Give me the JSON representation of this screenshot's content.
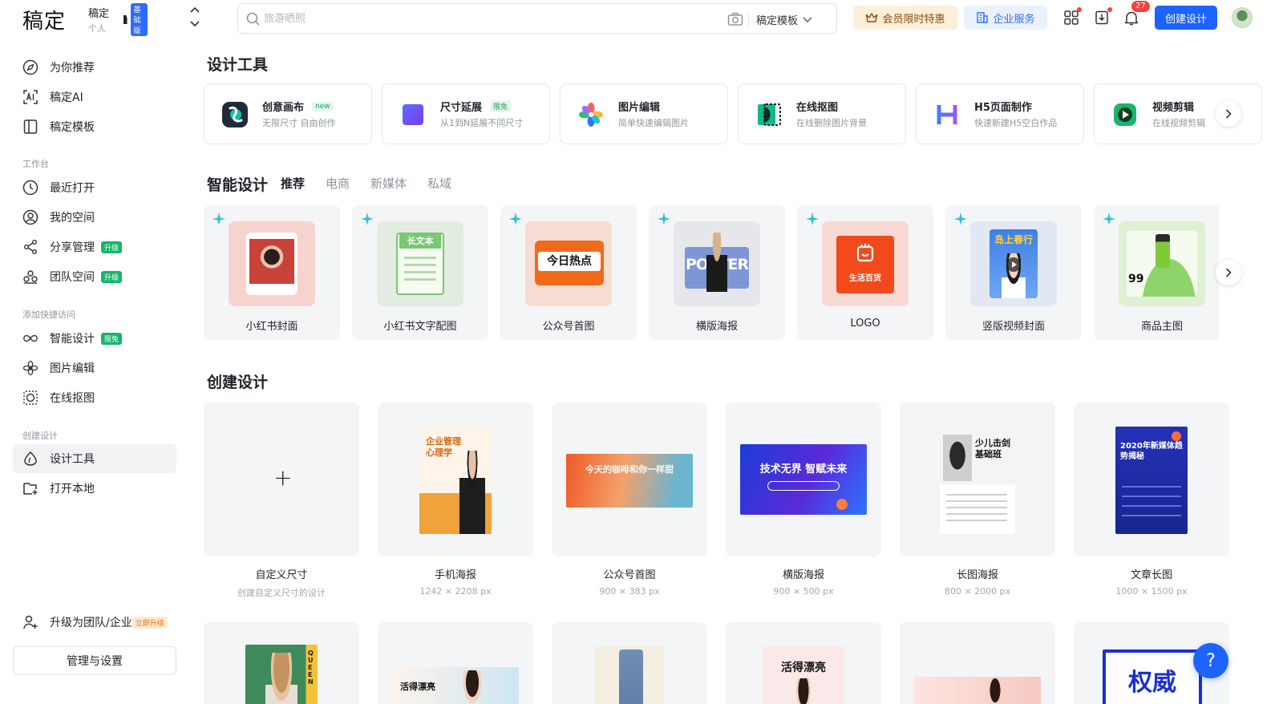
{
  "header": {
    "logo": "稿定",
    "workspace_name": "稿定",
    "workspace_tier": "基础版",
    "workspace_type": "个人",
    "search_placeholder": "旅游晒照",
    "search_scope": "稿定模板",
    "vip_label": "会员限时特惠",
    "enterprise_label": "企业服务",
    "notification_count": "27",
    "create_label": "创建设计"
  },
  "sidebar": {
    "top_items": [
      {
        "label": "为你推荐",
        "icon": "compass-icon"
      },
      {
        "label": "稿定AI",
        "icon": "ai-icon"
      },
      {
        "label": "稿定模板",
        "icon": "template-icon"
      }
    ],
    "sections": {
      "workbench": "工作台",
      "quick_access": "添加快捷访问",
      "create": "创建设计"
    },
    "workbench_items": [
      {
        "label": "最近打开",
        "icon": "clock-icon",
        "tag": ""
      },
      {
        "label": "我的空间",
        "icon": "user-circle-icon",
        "tag": ""
      },
      {
        "label": "分享管理",
        "icon": "share-icon",
        "tag": "升级"
      },
      {
        "label": "团队空间",
        "icon": "team-icon",
        "tag": "升级"
      }
    ],
    "quick_items": [
      {
        "label": "智能设计",
        "icon": "infinity-icon",
        "tag": "限免"
      },
      {
        "label": "图片编辑",
        "icon": "flower-icon",
        "tag": ""
      },
      {
        "label": "在线抠图",
        "icon": "cutout-icon",
        "tag": ""
      }
    ],
    "create_items": [
      {
        "label": "设计工具",
        "icon": "design-tool-icon"
      },
      {
        "label": "打开本地",
        "icon": "folder-plus-icon"
      }
    ],
    "upgrade_label": "升级为团队/企业",
    "upgrade_tag": "立即升级",
    "manage_label": "管理与设置"
  },
  "main": {
    "design_tools_title": "设计工具",
    "tools": [
      {
        "name": "创意画布",
        "desc": "无限尺寸 自由创作",
        "tag": "new"
      },
      {
        "name": "尺寸延展",
        "desc": "从1到N延展不同尺寸",
        "tag": "限免"
      },
      {
        "name": "图片编辑",
        "desc": "简单快速编辑图片",
        "tag": ""
      },
      {
        "name": "在线抠图",
        "desc": "在线删除图片背景",
        "tag": ""
      },
      {
        "name": "H5页面制作",
        "desc": "快速新建H5空白作品",
        "tag": ""
      },
      {
        "name": "视频剪辑",
        "desc": "在线视频剪辑",
        "tag": ""
      }
    ],
    "smart_title": "智能设计",
    "smart_tabs": [
      "推荐",
      "电商",
      "新媒体",
      "私域"
    ],
    "smart_items": [
      {
        "label": "小红书封面",
        "thumb_text": ""
      },
      {
        "label": "小红书文字配图",
        "thumb_text": "长文本"
      },
      {
        "label": "公众号首图",
        "thumb_text": "今日热点"
      },
      {
        "label": "横版海报",
        "thumb_text": "POSTER"
      },
      {
        "label": "LOGO",
        "thumb_text": "生活百货"
      },
      {
        "label": "竖版视频封面",
        "thumb_text": "岛上春行"
      },
      {
        "label": "商品主图",
        "thumb_text": "99"
      }
    ],
    "create_title": "创建设计",
    "create_items": [
      {
        "name": "自定义尺寸",
        "size": "创建自定义尺寸的设计",
        "thumb_text": ""
      },
      {
        "name": "手机海报",
        "size": "1242 × 2208 px",
        "thumb_text": "企业管理心理学"
      },
      {
        "name": "公众号首图",
        "size": "900 × 383 px",
        "thumb_text": "今天的咖啡和你一样甜"
      },
      {
        "name": "横版海报",
        "size": "900 × 500 px",
        "thumb_text": "技术无界 智赋未来"
      },
      {
        "name": "长图海报",
        "size": "800 × 2000 px",
        "thumb_text": "少儿击剑基础班"
      },
      {
        "name": "文章长图",
        "size": "1000 × 1500 px",
        "thumb_text": "2020年新媒体趋势揭秘"
      }
    ],
    "row3_texts": [
      "QUEEN",
      "活得漂亮",
      "",
      "活得漂亮",
      "",
      "权威"
    ]
  },
  "help_label": "?",
  "colors": {
    "accent": "#1d63ff",
    "green_tag": "#18b56a",
    "vip_bg": "#fdefd9",
    "card_bg": "#f4f5f7"
  }
}
